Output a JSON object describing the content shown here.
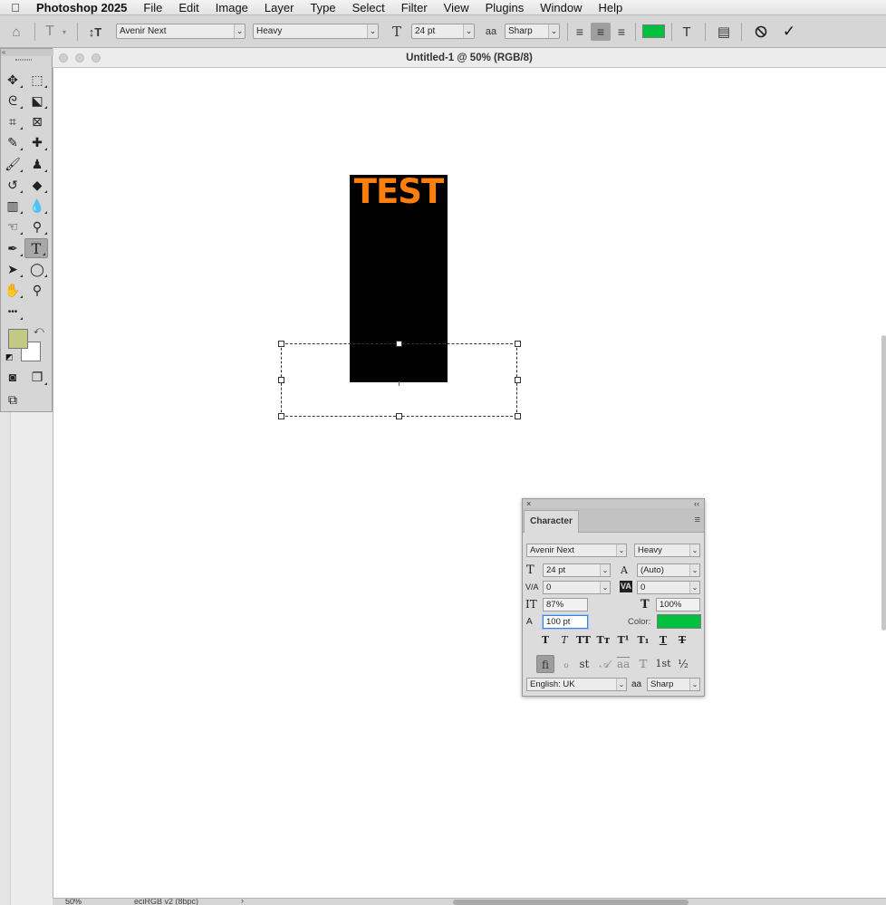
{
  "menubar": {
    "apple": "",
    "items": [
      "Photoshop 2025",
      "File",
      "Edit",
      "Image",
      "Layer",
      "Type",
      "Select",
      "Filter",
      "View",
      "Plugins",
      "Window",
      "Help"
    ]
  },
  "options": {
    "home_icon": "⌂",
    "type_tool_icon": "T",
    "orient_icon": "↕T",
    "font_family": "Avenir Next",
    "font_style": "Heavy",
    "size_icon": "T",
    "font_size": "24 pt",
    "aa_icon": "aa",
    "antialias": "Sharp",
    "align_left_icon": "≡",
    "align_center_icon": "≡",
    "align_right_icon": "≡",
    "text_color": "#00c040",
    "warp_icon": "T",
    "panel_icon": "▤",
    "cancel_icon": "⃠",
    "commit_icon": "✓"
  },
  "document": {
    "title": "Untitled-1 @ 50% (RGB/8)",
    "canvas_text": "TEST",
    "text_color": "#ff7f0a",
    "rect_color": "#000000",
    "status_zoom": "50%",
    "status_profile": "eciRGB v2 (8bpc)",
    "status_chev": "›"
  },
  "tools": {
    "collapse": "«",
    "items": [
      {
        "name": "move-tool",
        "icon": "✥"
      },
      {
        "name": "marquee-tool",
        "icon": "⬚"
      },
      {
        "name": "lasso-tool",
        "icon": "ᘓ"
      },
      {
        "name": "object-select-tool",
        "icon": "⬕"
      },
      {
        "name": "crop-tool",
        "icon": "⌗"
      },
      {
        "name": "frame-tool",
        "icon": "⊠"
      },
      {
        "name": "eyedropper-tool",
        "icon": "✎"
      },
      {
        "name": "healing-brush-tool",
        "icon": "✚"
      },
      {
        "name": "brush-tool",
        "icon": "🖌"
      },
      {
        "name": "clone-stamp-tool",
        "icon": "♟"
      },
      {
        "name": "history-brush-tool",
        "icon": "↺"
      },
      {
        "name": "eraser-tool",
        "icon": "◆"
      },
      {
        "name": "gradient-tool",
        "icon": "▥"
      },
      {
        "name": "blur-tool",
        "icon": "💧"
      },
      {
        "name": "dodge-tool",
        "icon": "⚲"
      },
      {
        "name": "smudge-tool",
        "icon": "☜"
      },
      {
        "name": "pen-tool",
        "icon": "✒"
      },
      {
        "name": "type-tool",
        "icon": "T"
      },
      {
        "name": "path-select-tool",
        "icon": "➤"
      },
      {
        "name": "ellipse-tool",
        "icon": "◯"
      },
      {
        "name": "hand-tool",
        "icon": "✋"
      },
      {
        "name": "zoom-tool",
        "icon": "⚲"
      },
      {
        "name": "more-tools",
        "icon": "•••"
      }
    ],
    "fg_color": "#c1c985",
    "bg_color": "#ffffff",
    "swap_icon": "⤺",
    "default_icon": "◩",
    "quickmask_icon": "◙",
    "screenmode_icon": "❐",
    "artboard_icon": "⧉"
  },
  "character": {
    "close": "×",
    "collapse": "‹‹",
    "tab": "Character",
    "menu": "≡",
    "font_family": "Avenir Next",
    "font_style": "Heavy",
    "size": "24 pt",
    "leading": "(Auto)",
    "kerning": "0",
    "tracking": "0",
    "vscale": "87%",
    "hscale": "100%",
    "baseline": "100 pt",
    "color_label": "Color:",
    "color": "#00c040",
    "language": "English: UK",
    "aa_label": "aa",
    "antialias": "Sharp",
    "icons": {
      "size": "T",
      "leading": "A",
      "kerning": "V/A",
      "tracking": "VA",
      "vscale": "IT",
      "hscale": "T",
      "baseline": "A"
    },
    "styles": [
      "T",
      "T",
      "TT",
      "Tт",
      "T¹",
      "T₁",
      "T",
      "T"
    ],
    "opentype": [
      "fi",
      "ℴ",
      "st",
      "𝒜",
      "aa",
      "𝕋",
      "1st",
      "½"
    ]
  }
}
